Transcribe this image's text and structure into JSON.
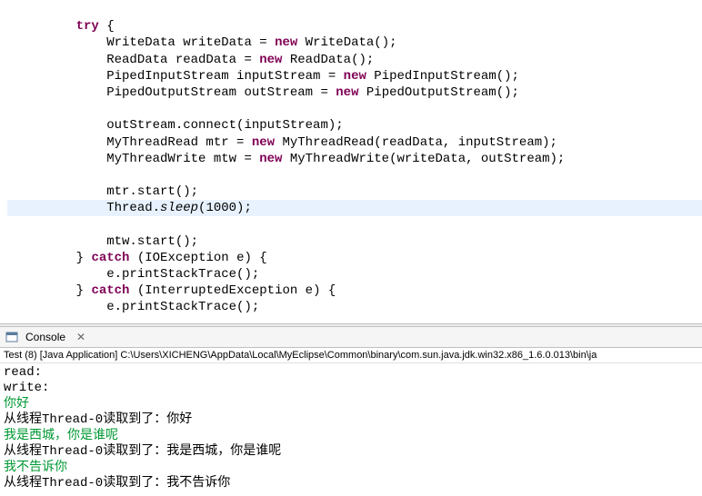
{
  "code": {
    "try": "try",
    "l1_a": "WriteData writeData = ",
    "l1_b": " WriteData();",
    "l2_a": "ReadData readData = ",
    "l2_b": " ReadData();",
    "l3_a": "PipedInputStream inputStream = ",
    "l3_b": " PipedInputStream();",
    "l4_a": "PipedOutputStream outStream = ",
    "l4_b": " PipedOutputStream();",
    "l5": "outStream.connect(inputStream);",
    "l6_a": "MyThreadRead mtr = ",
    "l6_b": " MyThreadRead(readData, inputStream);",
    "l7_a": "MyThreadWrite mtw = ",
    "l7_b": " MyThreadWrite(writeData, outStream);",
    "l8": "mtr.start();",
    "l9_a": "Thread.",
    "l9_b": "sleep",
    "l9_c": "(1000);",
    "l10": "mtw.start();",
    "catch1_a": "} ",
    "catch": "catch",
    "catch1_b": " (IOException e) {",
    "l11": "e.printStackTrace();",
    "catch2_b": " (InterruptedException e) {",
    "l12": "e.printStackTrace();",
    "new": "new"
  },
  "console": {
    "tab_label": "Console",
    "close": "✕",
    "info": "Test (8) [Java Application] C:\\Users\\XICHENG\\AppData\\Local\\MyEclipse\\Common\\binary\\com.sun.java.jdk.win32.x86_1.6.0.013\\bin\\ja",
    "out": [
      {
        "text": "read:",
        "cls": ""
      },
      {
        "text": "write:",
        "cls": ""
      },
      {
        "text": "你好",
        "cls": "green"
      },
      {
        "text": "从线程Thread-0读取到了：你好",
        "cls": ""
      },
      {
        "text": "我是西城，你是谁呢",
        "cls": "green"
      },
      {
        "text": "从线程Thread-0读取到了：我是西城，你是谁呢",
        "cls": ""
      },
      {
        "text": "我不告诉你",
        "cls": "green"
      },
      {
        "text": "从线程Thread-0读取到了：我不告诉你",
        "cls": ""
      }
    ]
  }
}
